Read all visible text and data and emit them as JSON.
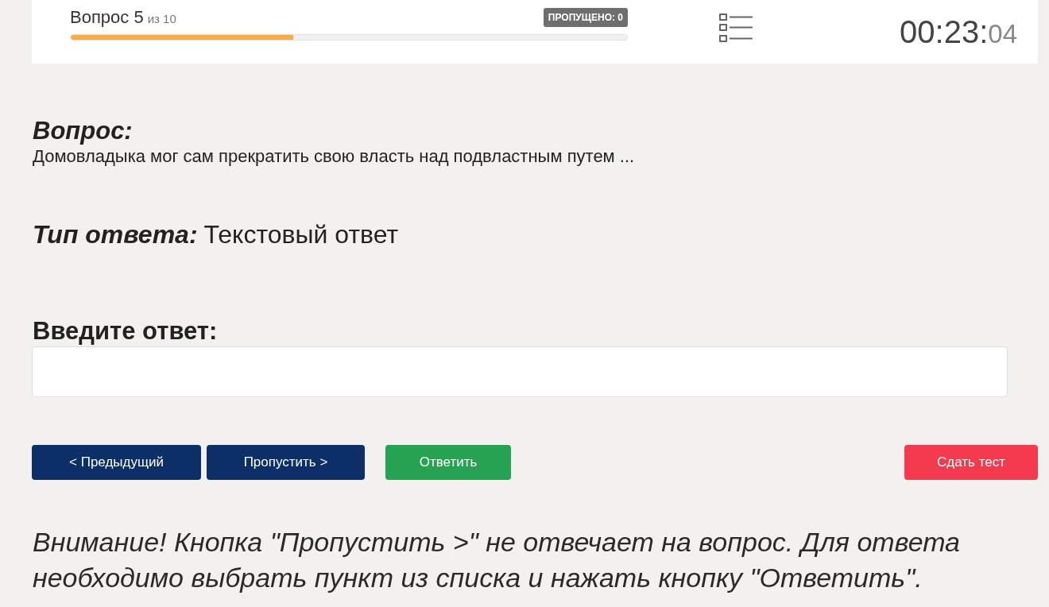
{
  "header": {
    "question_label": "Вопрос 5",
    "question_total": "из 10",
    "progress": {
      "level": 0.4
    },
    "skipped_badge": "ПРОПУЩЕНО: 0",
    "timer": {
      "main": "00:23:",
      "seconds": "04"
    }
  },
  "question": {
    "label": "Вопрос:",
    "text": "Домовладыка мог сам прекратить свою власть над подвластным путем ..."
  },
  "answer_type": {
    "label": "Тип ответа:",
    "value": "Текстовый ответ"
  },
  "answer": {
    "label": "Введите ответ:"
  },
  "buttons": [
    {
      "label": "< Предыдущий",
      "kind": "secondary"
    },
    {
      "label": "Пропустить >",
      "kind": "secondary"
    },
    {
      "label": "Ответить",
      "kind": "primary"
    },
    {
      "label": "Сдать тест",
      "kind": "danger"
    }
  ],
  "warning": "Внимание! Кнопка \"Пропустить >\" не отвечает на вопрос. Для ответа необходимо выбрать пункт из списка и нажать кнопку \"Ответить\"."
}
